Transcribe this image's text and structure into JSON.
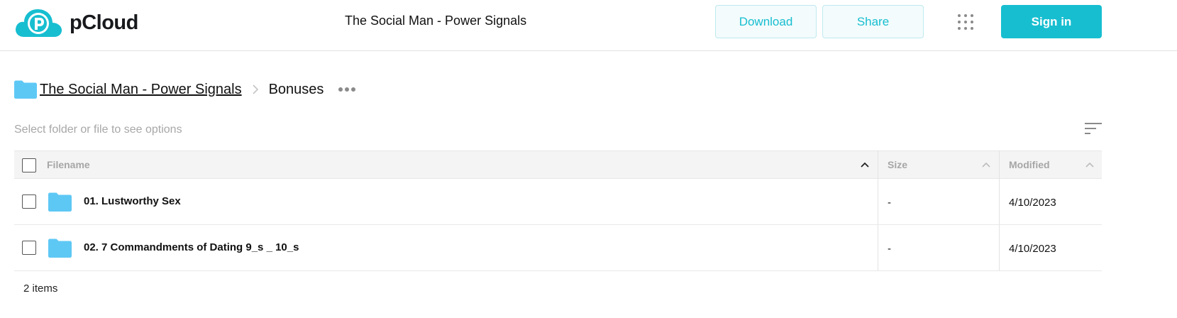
{
  "header": {
    "brand": "pCloud",
    "title": "The Social Man - Power Signals",
    "download_label": "Download",
    "share_label": "Share",
    "signin_label": "Sign in",
    "accent_color": "#17bed0"
  },
  "breadcrumb": {
    "root": "The Social Man - Power Signals",
    "current": "Bonuses"
  },
  "hint": "Select folder or file to see options",
  "table": {
    "columns": {
      "name": "Filename",
      "size": "Size",
      "modified": "Modified"
    },
    "rows": [
      {
        "name": "01. Lustworthy Sex",
        "size": "-",
        "modified": "4/10/2023",
        "icon": "folder-icon"
      },
      {
        "name": "02. 7 Commandments of Dating 9_s _ 10_s",
        "size": "-",
        "modified": "4/10/2023",
        "icon": "folder-icon"
      }
    ]
  },
  "footer": {
    "count": "2 items"
  }
}
